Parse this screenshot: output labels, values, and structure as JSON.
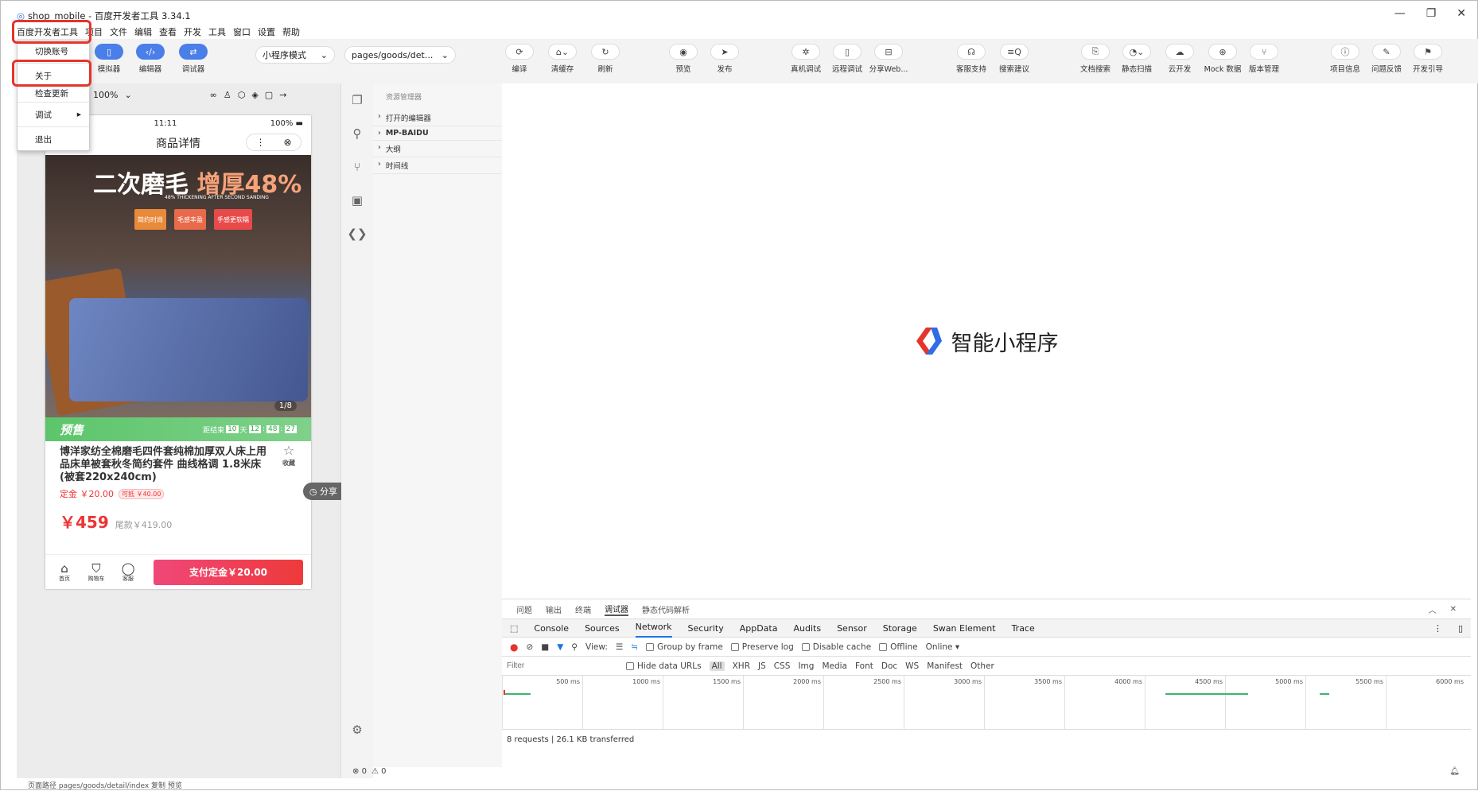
{
  "window": {
    "title": "shop_mobile - 百度开发者工具 3.34.1",
    "controls": [
      "—",
      "❐",
      "✕"
    ]
  },
  "menubar": {
    "items": [
      "百度开发者工具",
      "项目",
      "文件",
      "编辑",
      "查看",
      "开发",
      "工具",
      "窗口",
      "设置",
      "帮助"
    ]
  },
  "toolbar": {
    "left_buttons": [
      {
        "label": "模拟器",
        "icon": "phone-icon"
      },
      {
        "label": "编辑器",
        "icon": "code-icon"
      },
      {
        "label": "调试器",
        "icon": "swap-icon"
      }
    ],
    "mode_select": "小程序模式",
    "path_select": "pages/goods/det...",
    "actions": [
      "编译",
      "清缓存",
      "刷新",
      "预览",
      "发布",
      "真机调试",
      "远程调试",
      "分享Web...",
      "客服支持",
      "搜索建议",
      "文档搜索",
      "静态扫描",
      "云开发",
      "Mock 数据",
      "版本管理",
      "项目信息",
      "问题反馈",
      "开发引导"
    ]
  },
  "app_menu": {
    "items": [
      "切换账号",
      "关于",
      "检查更新",
      "调试",
      "退出"
    ]
  },
  "simulator": {
    "zoom": "100%",
    "status_time": "11:11",
    "status_battery": "100%",
    "nav_title": "商品详情",
    "banner_title_a": "二次磨毛",
    "banner_title_b": "增厚48%",
    "banner_sub": "48% THICKENING AFTER SECOND SANDING",
    "badges": [
      "简约时尚",
      "毛感丰盈",
      "手感更软糯"
    ],
    "image_index": "1/8",
    "presale_label": "预售",
    "countdown_label": "距结束",
    "countdown": [
      "10",
      "天",
      "12",
      ":",
      "48",
      ":",
      "27"
    ],
    "product_title": "博洋家纺全棉磨毛四件套纯棉加厚双人床上用品床单被套秋冬简约套件 曲线格调 1.8米床(被套220x240cm)",
    "fav_label": "收藏",
    "deposit": "定金 ￥20.00",
    "deposit_tag": "可抵 ￥40.00",
    "price": "￥459",
    "balance": "尾款￥419.00",
    "share": "分享",
    "nav": [
      {
        "label": "首页",
        "icon": "home-icon"
      },
      {
        "label": "购物车",
        "icon": "cart-icon"
      },
      {
        "label": "客服",
        "icon": "chat-icon"
      }
    ],
    "pay_button": "支付定金￥20.00"
  },
  "explorer": {
    "header": "资源管理器",
    "sections": [
      "打开的编辑器",
      "MP-BAIDU",
      "大纲",
      "时间线"
    ]
  },
  "editor": {
    "logo_text": "智能小程序"
  },
  "devtools": {
    "panel_tabs": [
      "问题",
      "输出",
      "终端",
      "调试器",
      "静态代码解析"
    ],
    "active_panel": "调试器",
    "tabs": [
      "Console",
      "Sources",
      "Network",
      "Security",
      "AppData",
      "Audits",
      "Sensor",
      "Storage",
      "Swan Element",
      "Trace"
    ],
    "active_tab": "Network",
    "view_label": "View:",
    "group_by_frame": "Group by frame",
    "preserve_log": "Preserve log",
    "disable_cache": "Disable cache",
    "offline": "Offline",
    "online": "Online",
    "filter_placeholder": "Filter",
    "hide_data_urls": "Hide data URLs",
    "types": [
      "All",
      "XHR",
      "JS",
      "CSS",
      "Img",
      "Media",
      "Font",
      "Doc",
      "WS",
      "Manifest",
      "Other"
    ],
    "ticks": [
      "500 ms",
      "1000 ms",
      "1500 ms",
      "2000 ms",
      "2500 ms",
      "3000 ms",
      "3500 ms",
      "4000 ms",
      "4500 ms",
      "5000 ms",
      "5500 ms",
      "6000 ms"
    ],
    "summary": "8 requests | 26.1 KB transferred"
  },
  "statusbar": {
    "errors": "0",
    "warnings": "0"
  },
  "bottom": {
    "text": "页面路径   pages/goods/detail/index   复制   预览"
  }
}
